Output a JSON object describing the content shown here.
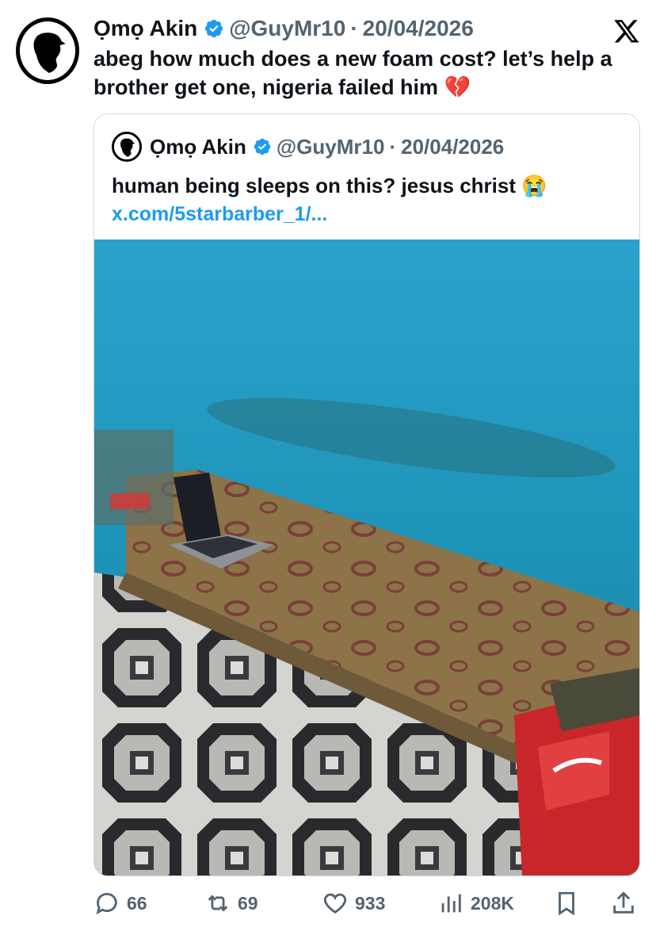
{
  "tweet": {
    "author_name": "Ọmọ Akin",
    "handle": "@GuyMr10",
    "separator": "·",
    "date": "20/04/2026",
    "text": "abeg how much does a new foam cost? let’s help a brother get one, nigeria failed him 💔"
  },
  "quoted": {
    "author_name": "Ọmọ Akin",
    "handle": "@GuyMr10",
    "separator": "·",
    "date": "20/04/2026",
    "text": "human being sleeps on this? jesus christ 😭",
    "link": "x.com/5starbarber_1/..."
  },
  "actions": {
    "replies": "66",
    "reposts": "69",
    "likes": "933",
    "views": "208K"
  },
  "colors": {
    "verified": "#1d9bf0",
    "link": "#1d9bf0",
    "muted": "#536471"
  },
  "icons": [
    "x-logo-icon",
    "verified-badge-icon",
    "reply-icon",
    "repost-icon",
    "like-icon",
    "views-icon",
    "bookmark-icon",
    "share-icon"
  ]
}
